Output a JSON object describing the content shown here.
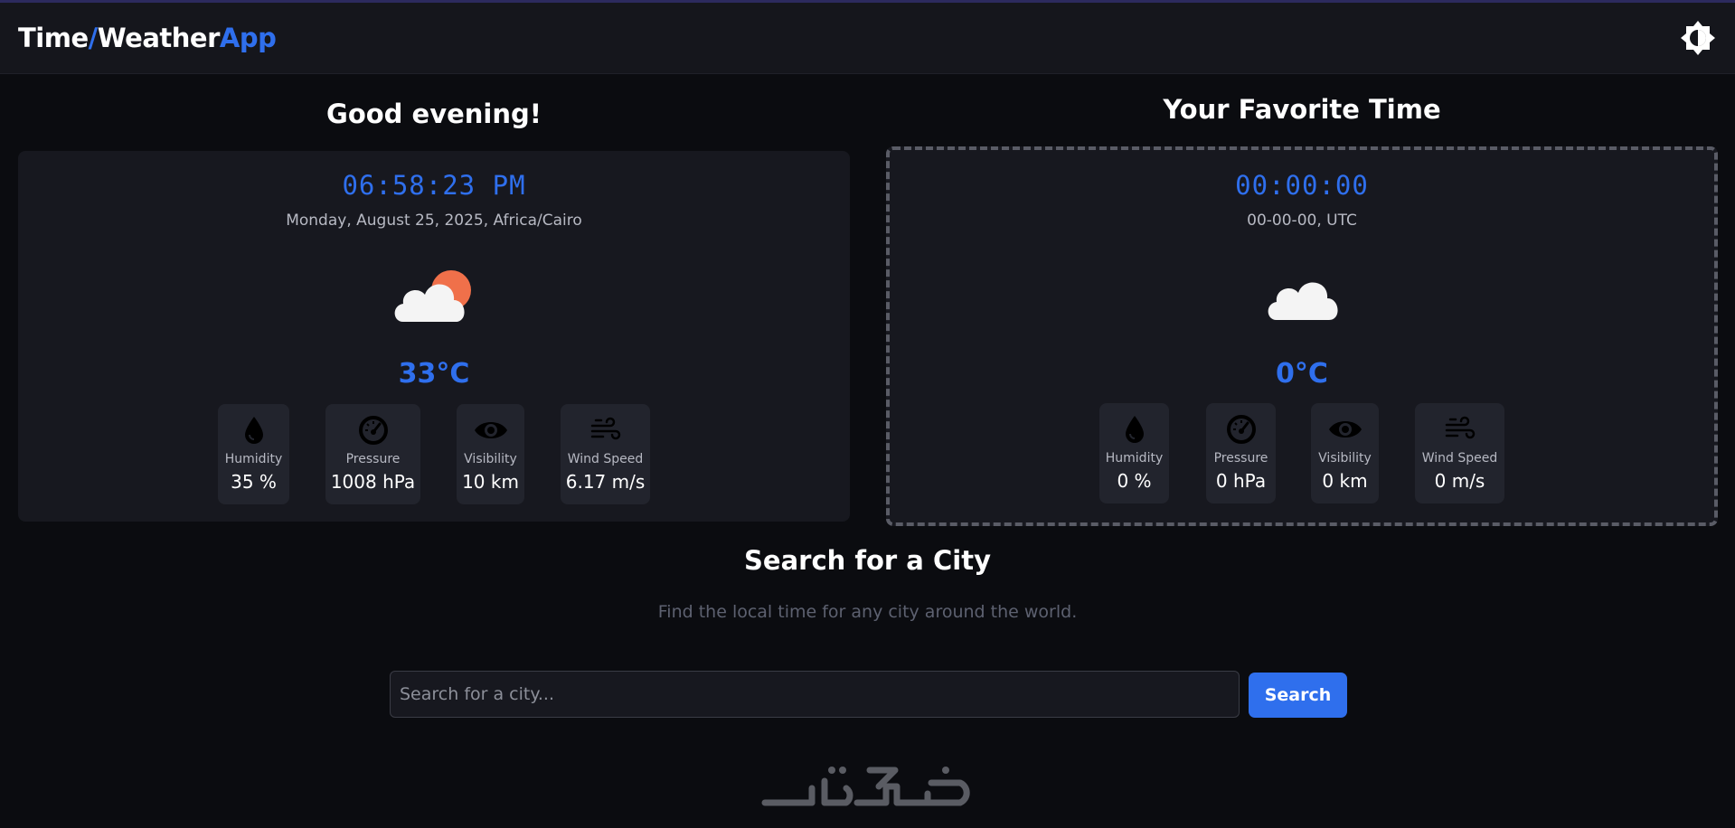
{
  "header": {
    "logo": {
      "part1": "Time",
      "slash": "/",
      "part2": "Weather",
      "part3": "App"
    },
    "theme_toggle_icon": "sun-icon"
  },
  "local": {
    "greeting": "Good evening!",
    "time": "06:58:23 PM",
    "date": "Monday, August 25, 2025, Africa/Cairo",
    "weather_icon": "partly-cloudy-icon",
    "temperature": "33°C",
    "stats": [
      {
        "icon": "droplet-icon",
        "label": "Humidity",
        "value": "35 %"
      },
      {
        "icon": "gauge-icon",
        "label": "Pressure",
        "value": "1008 hPa"
      },
      {
        "icon": "eye-icon",
        "label": "Visibility",
        "value": "10 km"
      },
      {
        "icon": "wind-icon",
        "label": "Wind Speed",
        "value": "6.17 m/s"
      }
    ]
  },
  "favorite": {
    "title": "Your Favorite Time",
    "time": "00:00:00",
    "date": "00-00-00, UTC",
    "weather_icon": "cloud-icon",
    "temperature": "0°C",
    "stats": [
      {
        "icon": "droplet-icon",
        "label": "Humidity",
        "value": "0 %"
      },
      {
        "icon": "gauge-icon",
        "label": "Pressure",
        "value": "0 hPa"
      },
      {
        "icon": "eye-icon",
        "label": "Visibility",
        "value": "0 km"
      },
      {
        "icon": "wind-icon",
        "label": "Wind Speed",
        "value": "0 m/s"
      }
    ]
  },
  "search": {
    "title": "Search for a City",
    "subtitle": "Find the local time for any city around the world.",
    "placeholder": "Search for a city...",
    "button_label": "Search"
  },
  "footer": {
    "brand_logo_text": "خمسات"
  },
  "colors": {
    "accent": "#2f6fed",
    "background": "#0b0c10",
    "card": "#17181f",
    "sun": "#f0704a"
  }
}
